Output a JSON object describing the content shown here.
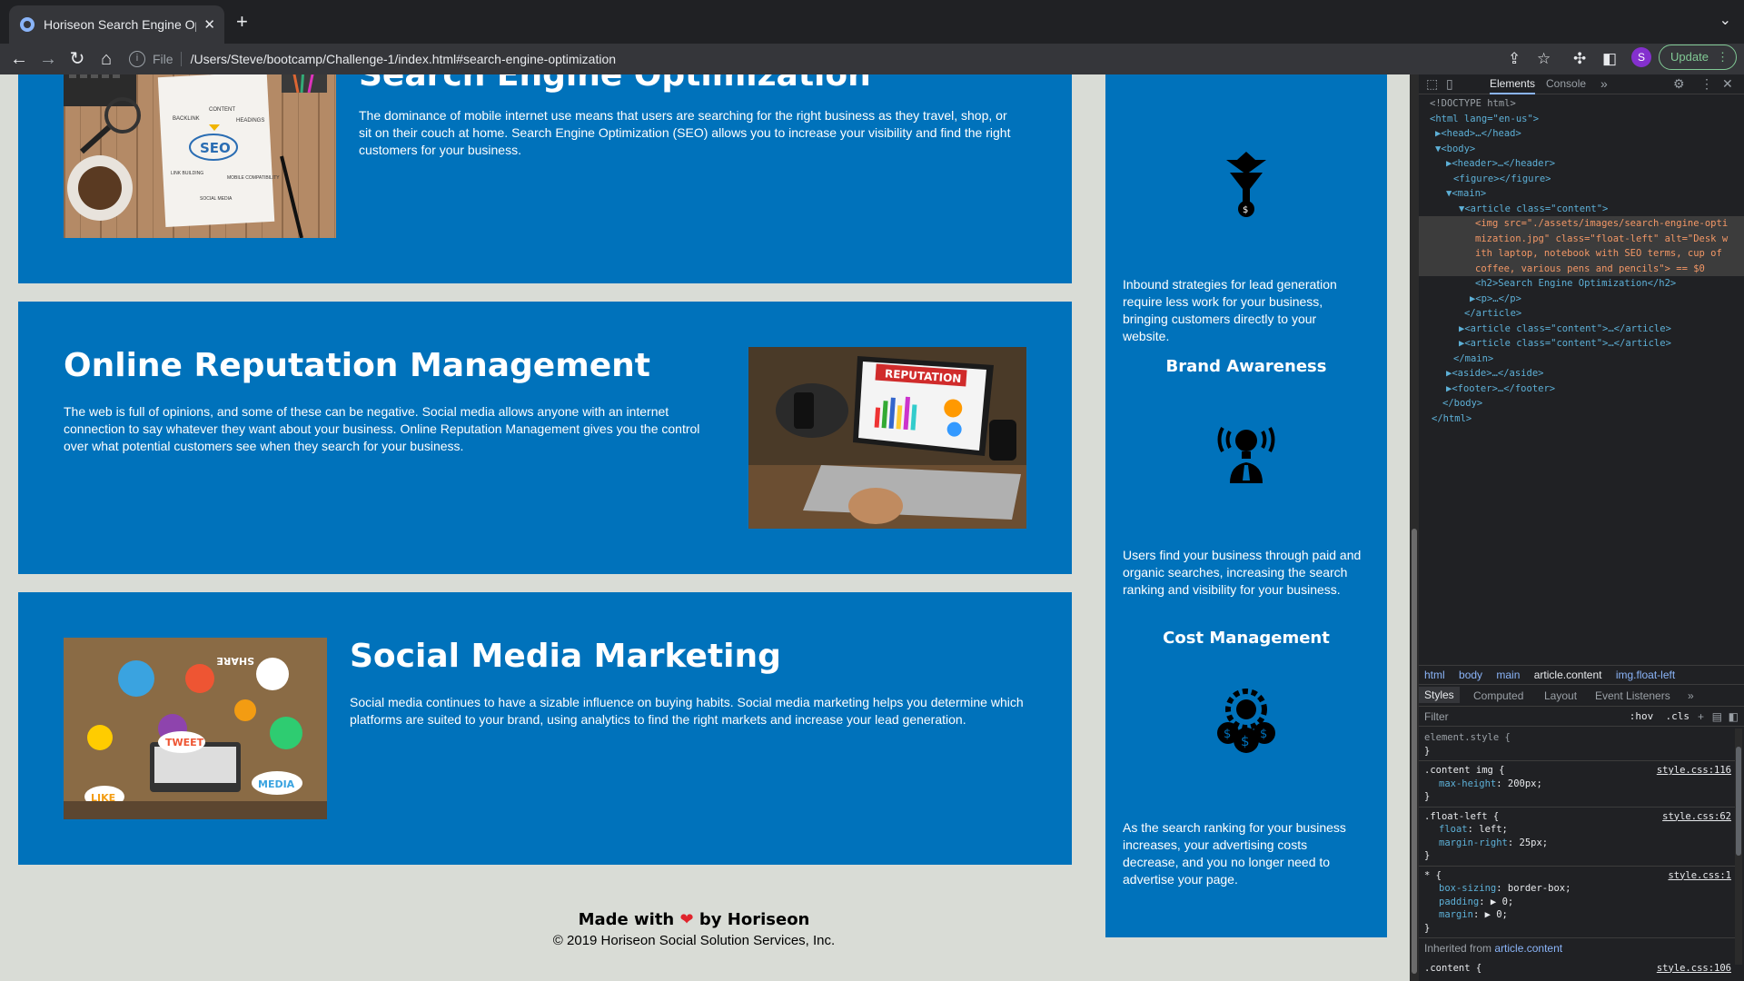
{
  "browser": {
    "tab_title": "Horiseon Search Engine Optim",
    "new_tab": "+",
    "address_prefix": "File",
    "url": "/Users/Steve/bootcamp/Challenge-1/index.html#search-engine-optimization",
    "profile_initial": "S",
    "update_label": "Update"
  },
  "page": {
    "seo": {
      "heading": "Search Engine Optimization",
      "text": "The dominance of mobile internet use means that users are searching for the right business as they travel, shop, or sit on their couch at home. Search Engine Optimization (SEO) allows you to increase your visibility and find the right customers for your business.",
      "image_words": [
        "CONTENT",
        "BACKLINK",
        "HEADINGS",
        "SEO",
        "LINK BUILDING",
        "MOBILE COMPATIBILITY",
        "SOCIAL MEDIA"
      ]
    },
    "orm": {
      "heading": "Online Reputation Management",
      "text": "The web is full of opinions, and some of these can be negative. Social media allows anyone with an internet connection to say whatever they want about your business. Online Reputation Management gives you the control over what potential customers see when they search for your business.",
      "image_word": "REPUTATION"
    },
    "smm": {
      "heading": "Social Media Marketing",
      "text": "Social media continues to have a sizable influence on buying habits. Social media marketing helps you determine which platforms are suited to your brand, using analytics to find the right markets and increase your lead generation.",
      "image_words": [
        "SHARE",
        "TWEET",
        "LIKE",
        "MEDIA"
      ]
    },
    "aside": {
      "lead_text": "Inbound strategies for lead generation require less work for your business, bringing customers directly to your website.",
      "brand_heading": "Brand Awareness",
      "brand_text": "Users find your business through paid and organic searches, increasing the search ranking and visibility for your business.",
      "cost_heading": "Cost Management",
      "cost_text": "As the search ranking for your business increases, your advertising costs decrease, and you no longer need to advertise your page."
    },
    "footer": {
      "made_prefix": "Made with",
      "made_suffix": "by Horiseon",
      "copyright": "© 2019 Horiseon Social Solution Services, Inc."
    }
  },
  "devtools": {
    "tabs": [
      "Elements",
      "Console"
    ],
    "dom": [
      {
        "t": "<!DOCTYPE html>"
      },
      {
        "t": "<html lang=\"en-us\">"
      },
      {
        "t": "▶<head>…</head>"
      },
      {
        "t": "▼<body>"
      },
      {
        "t": "▶<header>…</header>"
      },
      {
        "t": "<figure></figure>"
      },
      {
        "t": "▼<main>"
      },
      {
        "t": "▼<article class=\"content\">"
      },
      {
        "t": "<img src=\"./assets/images/search-engine-opti"
      },
      {
        "t": "mization.jpg\" class=\"float-left\" alt=\"Desk w"
      },
      {
        "t": "ith laptop, notebook with SEO terms, cup of"
      },
      {
        "t": "coffee, various pens and pencils\"> == $0"
      },
      {
        "t": "<h2>Search Engine Optimization</h2>"
      },
      {
        "t": "▶<p>…</p>"
      },
      {
        "t": "</article>"
      },
      {
        "t": "▶<article class=\"content\">…</article>"
      },
      {
        "t": "▶<article class=\"content\">…</article>"
      },
      {
        "t": "</main>"
      },
      {
        "t": "▶<aside>…</aside>"
      },
      {
        "t": "▶<footer>…</footer>"
      },
      {
        "t": "</body>"
      },
      {
        "t": "</html>"
      }
    ],
    "breadcrumbs": [
      "html",
      "body",
      "main",
      "article.content",
      "img.float-left"
    ],
    "style_tabs": [
      "Styles",
      "Computed",
      "Layout",
      "Event Listeners"
    ],
    "filter_placeholder": "Filter",
    "filter_hov": ":hov",
    "filter_cls": ".cls",
    "rules": [
      {
        "selector": "element.style {",
        "source": "",
        "props": []
      },
      {
        "selector": ".content img {",
        "source": "style.css:116",
        "props": [
          [
            "max-height",
            "200px;"
          ]
        ]
      },
      {
        "selector": ".float-left {",
        "source": "style.css:62",
        "props": [
          [
            "float",
            "left;"
          ],
          [
            "margin-right",
            "25px;"
          ]
        ]
      },
      {
        "selector": "* {",
        "source": "style.css:1",
        "props": [
          [
            "box-sizing",
            "border-box;"
          ],
          [
            "padding",
            "▶ 0;"
          ],
          [
            "margin",
            "▶ 0;"
          ]
        ]
      }
    ],
    "inherited_prefix": "Inherited from",
    "inherited_from": "article.content",
    "last_rule_selector": ".content {",
    "last_rule_source": "style.css:106"
  },
  "colors": {
    "article_bg": "#0072bb",
    "page_bg": "#d9dcd6"
  }
}
